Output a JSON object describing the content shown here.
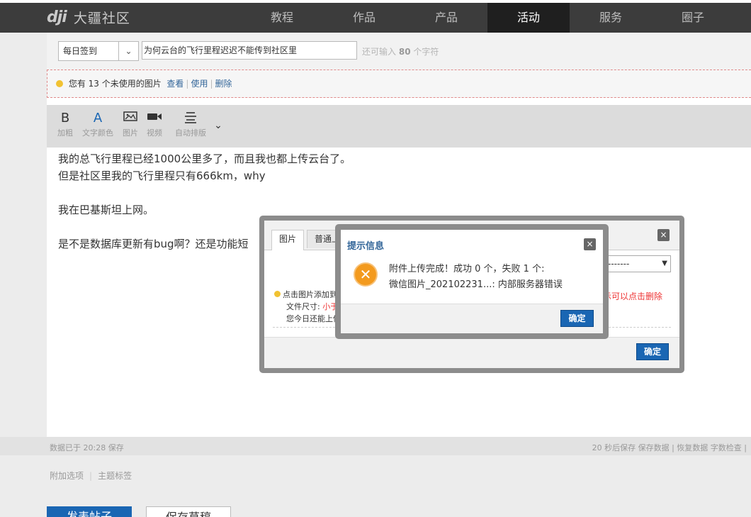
{
  "nav": {
    "logo_mark": "dji",
    "site_name": "大疆社区",
    "items": [
      {
        "label": "教程"
      },
      {
        "label": "作品"
      },
      {
        "label": "产品"
      },
      {
        "label": "活动",
        "active": true
      },
      {
        "label": "服务"
      },
      {
        "label": "圈子"
      }
    ]
  },
  "editor": {
    "category": "每日签到",
    "title": "为何云台的飞行里程迟迟不能传到社区里",
    "char_hint_prefix": "还可输入",
    "char_hint_count": "80",
    "char_hint_suffix": "个字符",
    "image_notice": {
      "text": "您有 13 个未使用的图片",
      "view": "查看",
      "use": "使用",
      "delete": "删除"
    },
    "toolbar": {
      "bold": {
        "glyph": "B",
        "label": "加粗"
      },
      "color": {
        "glyph": "A",
        "label": "文字颜色"
      },
      "image": {
        "label": "图片"
      },
      "video": {
        "label": "视频"
      },
      "format": {
        "label": "自动排版"
      }
    },
    "content_lines": [
      "我的总飞行里程已经1000公里多了，而且我也都上传云台了。",
      "但是社区里我的飞行里程只有666km，why",
      "",
      "我在巴基斯坦上网。",
      "",
      "是不是数据库更新有bug啊？还是功能短"
    ]
  },
  "status": {
    "saved": "数据已于 20:28 保存",
    "right": "20 秒后保存 保存数据 | 恢复数据    字数检查 |"
  },
  "extra": {
    "options": "附加选项",
    "tags": "主题标签"
  },
  "buttons": {
    "post": "发表帖子",
    "draft": "保存草稿"
  },
  "upload_dialog": {
    "tab_image": "图片",
    "tab_normal": "普通上",
    "close": "×",
    "select_value": "-------",
    "tip_line1": "点击图片添加到",
    "tip_line2_prefix": "文件尺寸: ",
    "tip_line2_red": "小于",
    "tip_line3": "您今日还能上传",
    "tip_right": "示可以点击删除",
    "ok": "确定"
  },
  "alert": {
    "title": "提示信息",
    "close": "×",
    "line1": "附件上传完成！成功 0 个，失败 1 个:",
    "line2": "微信图片_202102231...: 内部服务器错误",
    "ok": "确定",
    "icon": "error-x-icon",
    "icon_color": "#f39a1e"
  }
}
